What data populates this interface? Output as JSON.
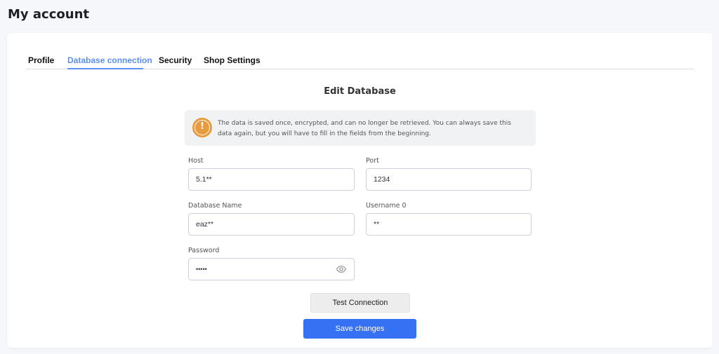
{
  "header": {
    "title": "My account"
  },
  "tabs": [
    {
      "label": "Profile"
    },
    {
      "label": "Database connection",
      "active": true
    },
    {
      "label": "Security"
    },
    {
      "label": "Shop Settings"
    }
  ],
  "form": {
    "title": "Edit Database",
    "notice": {
      "icon": "warning-icon",
      "text": "The data is saved once, encrypted, and can no longer be retrieved. You can always save this data again, but you will have to fill in the fields from the beginning."
    },
    "host": {
      "label": "Host",
      "value": "5.1**"
    },
    "port": {
      "label": "Port",
      "value": "1234"
    },
    "database_name": {
      "label": "Database Name",
      "value": "eaz**"
    },
    "username": {
      "label": "Username 0",
      "value": "**"
    },
    "password": {
      "label": "Password",
      "value": "•••••",
      "icon": "eye-icon"
    },
    "test_button": "Test Connection",
    "save_button": "Save changes"
  },
  "colors": {
    "accent": "#5b8ff0",
    "primary_button": "#3571f2",
    "warning": "#e89a3e"
  }
}
